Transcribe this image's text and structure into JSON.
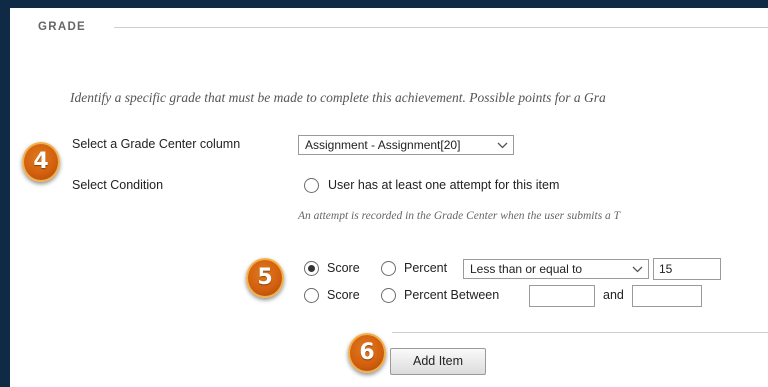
{
  "section": {
    "title": "GRADE"
  },
  "intro_text": "Identify a specific grade that must be made to complete this achievement. Possible points for a Gra",
  "grade_column": {
    "label": "Select a Grade Center column",
    "selected": "Assignment - Assignment[20]",
    "chevron_icon": "chevron-down-icon"
  },
  "condition": {
    "label": "Select Condition",
    "attempt_option": "User has at least one attempt for this item",
    "hint": "An attempt is recorded in the Grade Center when the user submits a T"
  },
  "score_row1": {
    "score_label": "Score",
    "percent_label": "Percent",
    "operator": "Less than or equal to",
    "value": "15"
  },
  "score_row2": {
    "score_label": "Score",
    "percent_label": "Percent Between",
    "and_label": "and",
    "value_from": "",
    "value_to": ""
  },
  "actions": {
    "add_item": "Add Item"
  },
  "badges": {
    "step4": "4",
    "step5": "5",
    "step6": "6"
  },
  "colors": {
    "frame": "#0f2a44",
    "badge": "#d3600f",
    "badge_border": "#f1b04a"
  }
}
